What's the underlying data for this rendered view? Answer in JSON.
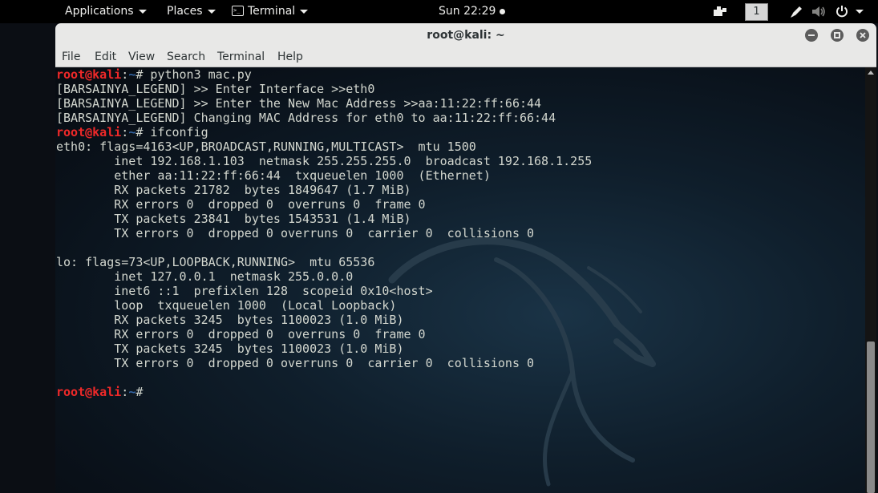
{
  "topbar": {
    "applications": "Applications",
    "places": "Places",
    "terminal": "Terminal",
    "clock": "Sun 22:29",
    "workspace": "1",
    "icons": [
      "workspaces-icon",
      "pen-icon",
      "volume-icon",
      "power-icon"
    ]
  },
  "window": {
    "title": "root@kali: ~",
    "menu": [
      "File",
      "Edit",
      "View",
      "Search",
      "Terminal",
      "Help"
    ]
  },
  "prompt": {
    "user": "root@kali",
    "sep": ":",
    "dir": "~",
    "hash": "#"
  },
  "terminal": {
    "lines": [
      {
        "type": "prompt",
        "cmd": " python3 mac.py"
      },
      {
        "type": "out",
        "text": "[BARSAINYA_LEGEND] >> Enter Interface >>eth0"
      },
      {
        "type": "out",
        "text": "[BARSAINYA_LEGEND] >> Enter the New Mac Address >>aa:11:22:ff:66:44"
      },
      {
        "type": "out",
        "text": "[BARSAINYA_LEGEND] Changing MAC Address for eth0 to aa:11:22:ff:66:44"
      },
      {
        "type": "prompt",
        "cmd": " ifconfig"
      },
      {
        "type": "out",
        "text": "eth0: flags=4163<UP,BROADCAST,RUNNING,MULTICAST>  mtu 1500"
      },
      {
        "type": "out",
        "text": "        inet 192.168.1.103  netmask 255.255.255.0  broadcast 192.168.1.255"
      },
      {
        "type": "out",
        "text": "        ether aa:11:22:ff:66:44  txqueuelen 1000  (Ethernet)"
      },
      {
        "type": "out",
        "text": "        RX packets 21782  bytes 1849647 (1.7 MiB)"
      },
      {
        "type": "out",
        "text": "        RX errors 0  dropped 0  overruns 0  frame 0"
      },
      {
        "type": "out",
        "text": "        TX packets 23841  bytes 1543531 (1.4 MiB)"
      },
      {
        "type": "out",
        "text": "        TX errors 0  dropped 0 overruns 0  carrier 0  collisions 0"
      },
      {
        "type": "out",
        "text": ""
      },
      {
        "type": "out",
        "text": "lo: flags=73<UP,LOOPBACK,RUNNING>  mtu 65536"
      },
      {
        "type": "out",
        "text": "        inet 127.0.0.1  netmask 255.0.0.0"
      },
      {
        "type": "out",
        "text": "        inet6 ::1  prefixlen 128  scopeid 0x10<host>"
      },
      {
        "type": "out",
        "text": "        loop  txqueuelen 1000  (Local Loopback)"
      },
      {
        "type": "out",
        "text": "        RX packets 3245  bytes 1100023 (1.0 MiB)"
      },
      {
        "type": "out",
        "text": "        RX errors 0  dropped 0  overruns 0  frame 0"
      },
      {
        "type": "out",
        "text": "        TX packets 3245  bytes 1100023 (1.0 MiB)"
      },
      {
        "type": "out",
        "text": "        TX errors 0  dropped 0 overruns 0  carrier 0  collisions 0"
      },
      {
        "type": "out",
        "text": ""
      },
      {
        "type": "prompt",
        "cmd": ""
      }
    ]
  },
  "colors": {
    "prompt_user": "#ef2929",
    "prompt_dir": "#3465a4",
    "output_text": "#d3d7cf",
    "topbar_bg": "#000000"
  }
}
